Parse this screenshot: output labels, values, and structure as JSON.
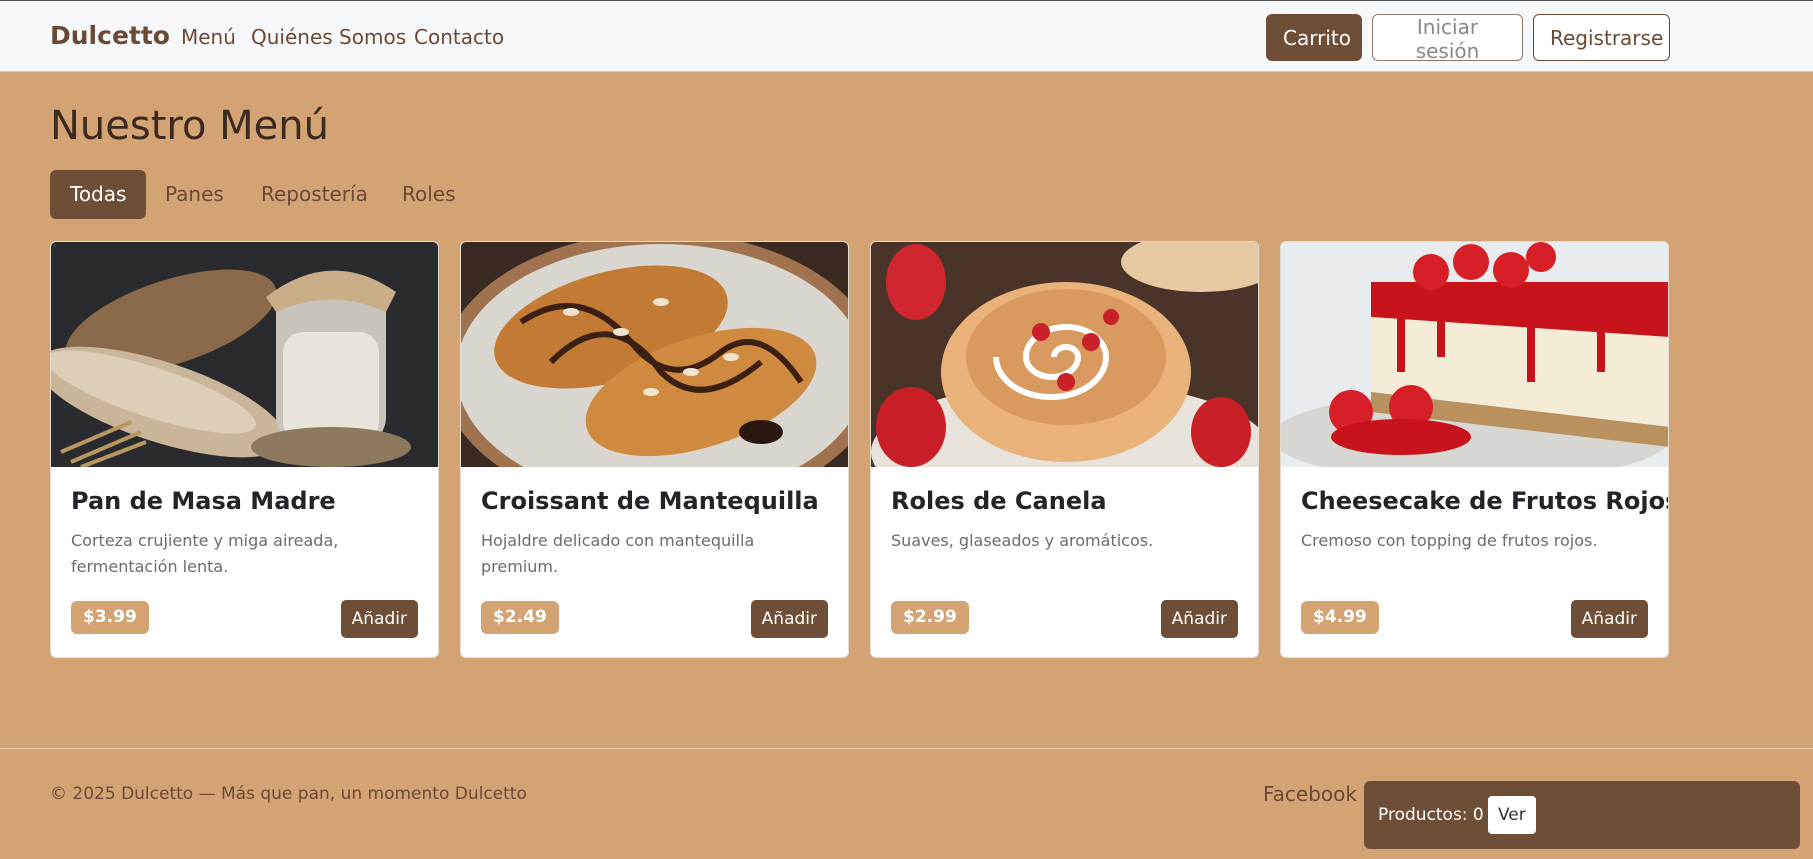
{
  "header": {
    "brand": "Dulcetto",
    "nav": [
      "Menú",
      "Quiénes Somos",
      "Contacto"
    ],
    "cart_label": "Carrito",
    "login_label": "Iniciar sesión",
    "register_label": "Registrarse"
  },
  "main": {
    "title": "Nuestro Menú",
    "filters": [
      "Todas",
      "Panes",
      "Repostería",
      "Roles"
    ],
    "products": [
      {
        "name": "Pan de Masa Madre",
        "desc": "Corteza crujiente y miga aireada, fermentación lenta.",
        "price": "$3.99",
        "button": "Añadir"
      },
      {
        "name": "Croissant de Mantequilla",
        "desc": "Hojaldre delicado con mantequilla premium.",
        "price": "$2.49",
        "button": "Añadir"
      },
      {
        "name": "Roles de Canela",
        "desc": "Suaves, glaseados y aromáticos.",
        "price": "$2.99",
        "button": "Añadir"
      },
      {
        "name": "Cheesecake de Frutos Rojos",
        "desc": "Cremoso con topping de frutos rojos.",
        "price": "$4.99",
        "button": "Añadir"
      }
    ]
  },
  "footer": {
    "copyright": "© 2025 Dulcetto — Más que pan, un momento Dulcetto",
    "social": "Facebook"
  },
  "cart_toast": {
    "text": "Productos: 0",
    "button": "Ver"
  },
  "colors": {
    "background": "#d4a373",
    "accent": "#6f4e37",
    "navbar": "#f7f8fa"
  }
}
